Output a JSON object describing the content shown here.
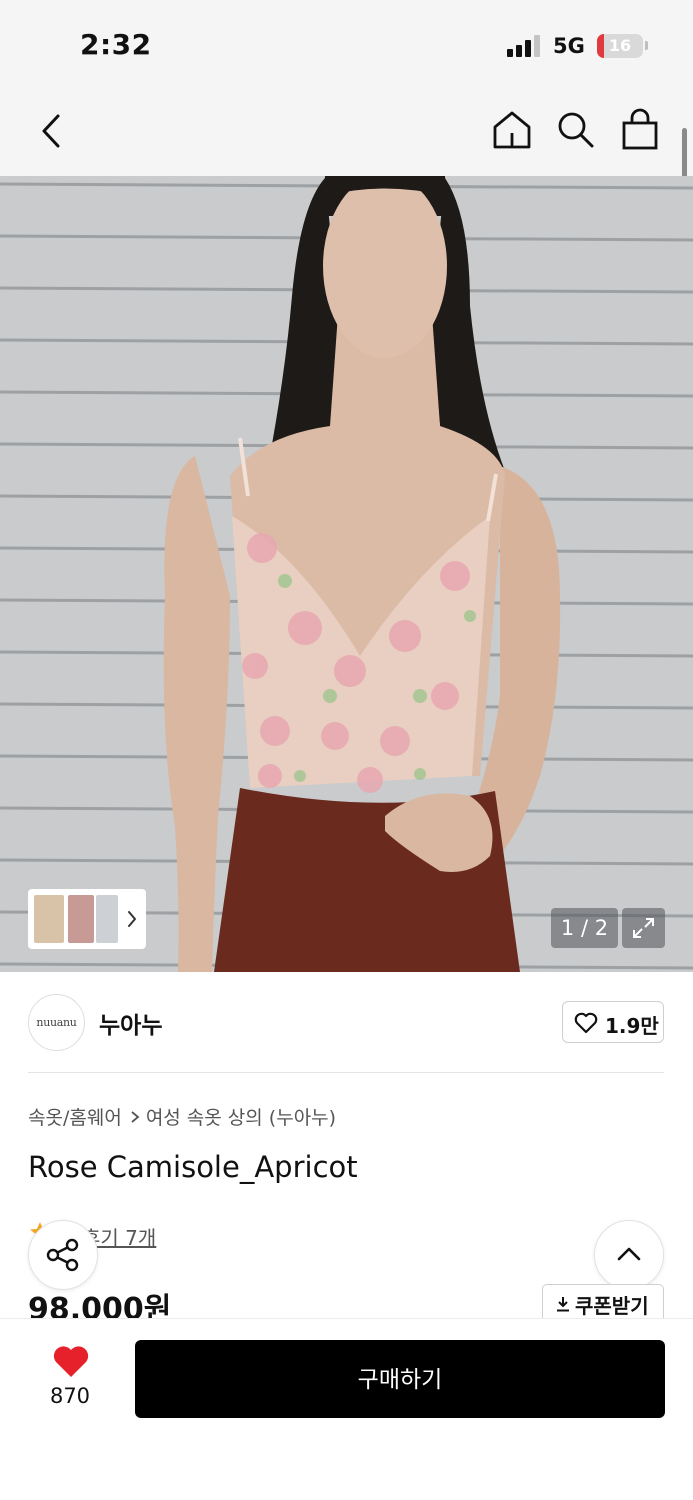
{
  "status_bar": {
    "time": "2:32",
    "network": "5G",
    "battery": "16",
    "battery_level": 0.16,
    "icons": [
      "signal-icon",
      "battery-icon"
    ]
  },
  "nav": {
    "icons": [
      "back-arrow-icon",
      "home-icon",
      "search-icon",
      "shopping-bag-icon"
    ]
  },
  "gallery": {
    "page_counter": "1 / 2",
    "icons": [
      "chevron-right-icon",
      "expand-icon"
    ]
  },
  "brand": {
    "logo_text": "nuuanu",
    "name": "누아누",
    "like_count": "1.9만",
    "icons": [
      "heart-outline-icon"
    ]
  },
  "product": {
    "breadcrumb": [
      "속옷/홈웨어",
      "여성 속옷 상의 (누아누)"
    ],
    "title": "Rose Camisole_Apricot",
    "review_link": "후기 7개",
    "price": "98,000원",
    "coupon_label": "쿠폰받기",
    "icons": [
      "star-icon",
      "share-icon",
      "chevron-up-icon",
      "download-icon"
    ]
  },
  "bottom_bar": {
    "wish_count": "870",
    "buy_label": "구매하기",
    "icons": [
      "heart-filled-icon"
    ]
  },
  "colors": {
    "accent_red": "#e6212b",
    "buy_button": "#000000",
    "star": "#f5a623"
  }
}
